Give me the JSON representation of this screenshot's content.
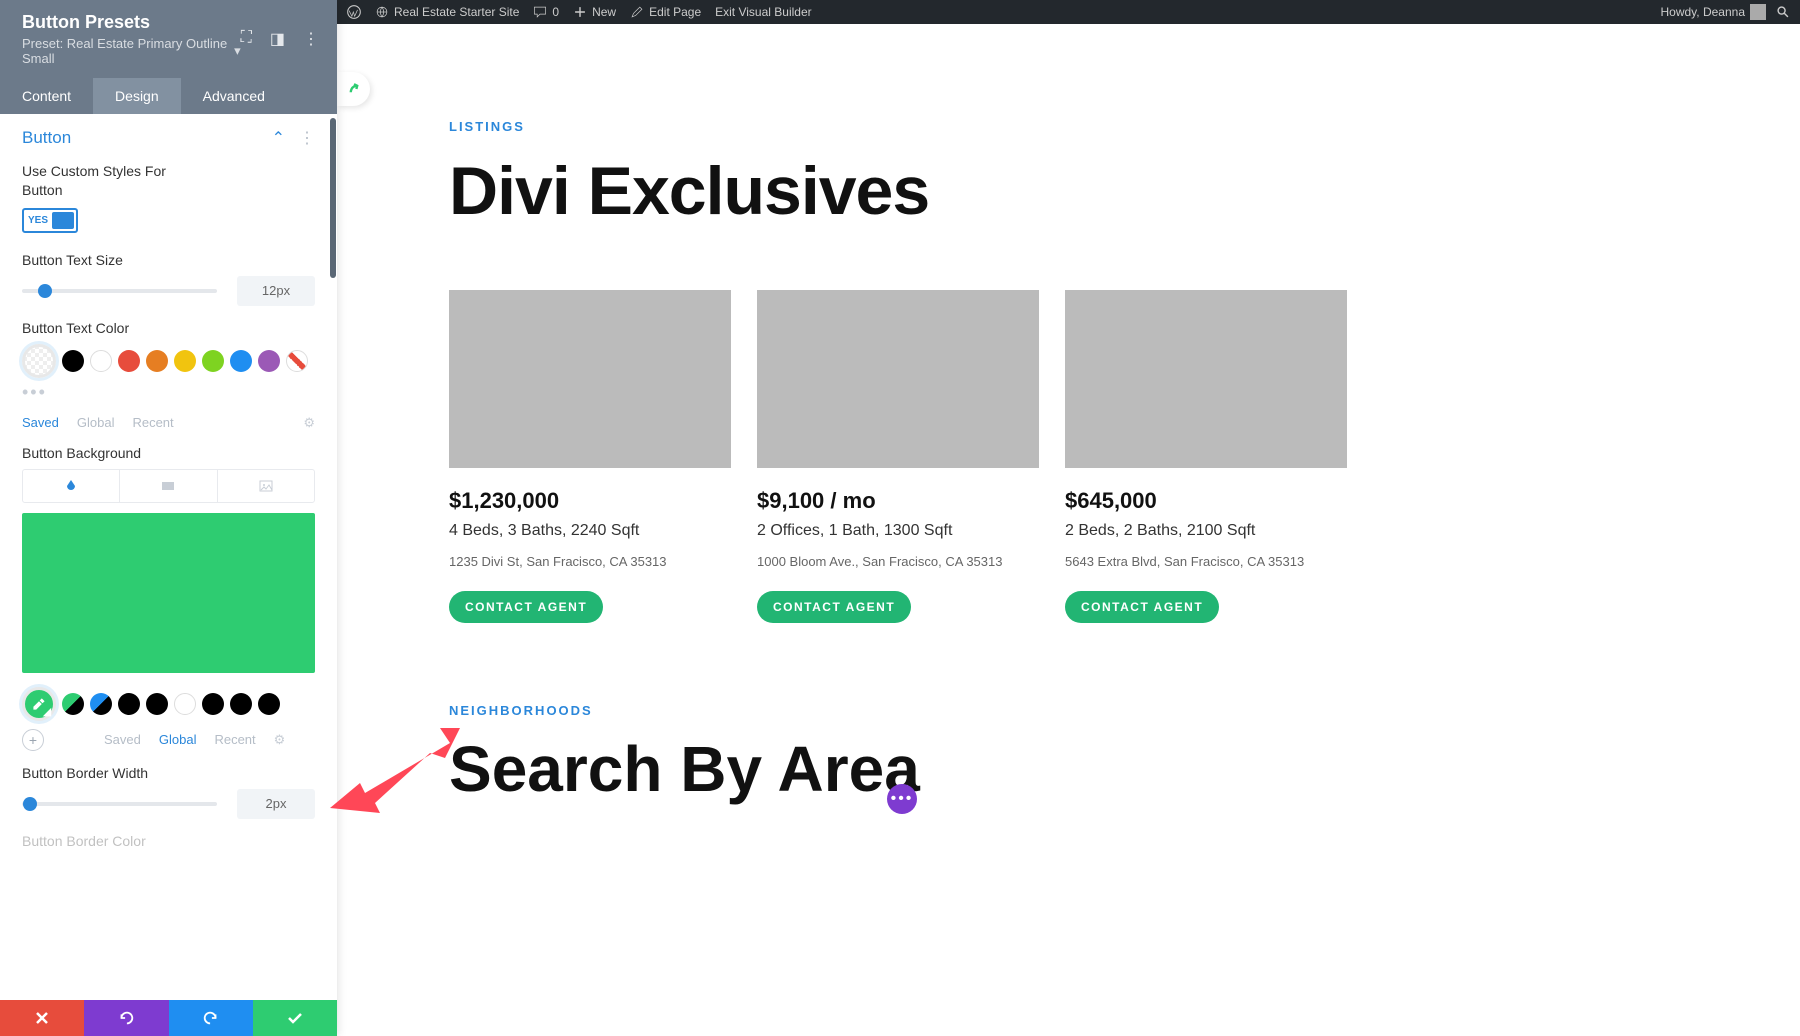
{
  "wp_bar": {
    "site_name": "Real Estate Starter Site",
    "comments": "0",
    "new": "New",
    "edit_page": "Edit Page",
    "exit_vb": "Exit Visual Builder",
    "howdy": "Howdy, Deanna"
  },
  "sidebar": {
    "title": "Button Presets",
    "preset_label": "Preset: Real Estate Primary Outline Small",
    "tabs": {
      "content": "Content",
      "design": "Design",
      "advanced": "Advanced",
      "active": "design"
    },
    "section_title": "Button",
    "fields": {
      "custom_styles_label": "Use Custom Styles For Button",
      "custom_styles_value": "YES",
      "text_size_label": "Button Text Size",
      "text_size_value": "12px",
      "text_size_slider_pct": 12,
      "text_color_label": "Button Text Color",
      "text_color_meta": {
        "saved": "Saved",
        "global": "Global",
        "recent": "Recent"
      },
      "bg_label": "Button Background",
      "bg_color": "#2ecc71",
      "bg_meta": {
        "saved": "Saved",
        "global": "Global",
        "recent": "Recent"
      },
      "border_width_label": "Button Border Width",
      "border_width_value": "2px",
      "border_width_slider_pct": 4,
      "border_color_label_partial": "Button Border Color"
    },
    "text_color_swatches": [
      "#000000",
      "#ffffff",
      "#e74c3c",
      "#e67e22",
      "#f1c40f",
      "#7ed321",
      "#1f8ef1",
      "#9b59b6",
      "stripe"
    ],
    "bg_preset_swatches": [
      {
        "c": "#2ecc71",
        "split": true
      },
      {
        "c": "#1f8ef1",
        "split": true
      },
      {
        "c": "#000",
        "split": false
      },
      {
        "c": "#000",
        "split": false
      },
      {
        "c": "#fff",
        "split": false,
        "border": true
      },
      {
        "c": "#000",
        "split": false
      },
      {
        "c": "#000",
        "split": false
      },
      {
        "c": "#000",
        "split": false
      }
    ]
  },
  "page": {
    "listings_eyebrow": "LISTINGS",
    "listings_title": "Divi Exclusives",
    "cta_label": "CONTACT AGENT",
    "cards": [
      {
        "price": "$1,230,000",
        "specs": "4 Beds, 3 Baths, 2240 Sqft",
        "addr": "1235 Divi St, San Fracisco, CA 35313"
      },
      {
        "price": "$9,100 / mo",
        "specs": "2 Offices, 1 Bath, 1300 Sqft",
        "addr": "1000 Bloom Ave., San Fracisco, CA 35313"
      },
      {
        "price": "$645,000",
        "specs": "2 Beds, 2 Baths, 2100 Sqft",
        "addr": "5643 Extra Blvd, San Fracisco, CA 35313"
      }
    ],
    "neighborhoods_eyebrow": "NEIGHBORHOODS",
    "neighborhoods_title": "Search By Area"
  }
}
